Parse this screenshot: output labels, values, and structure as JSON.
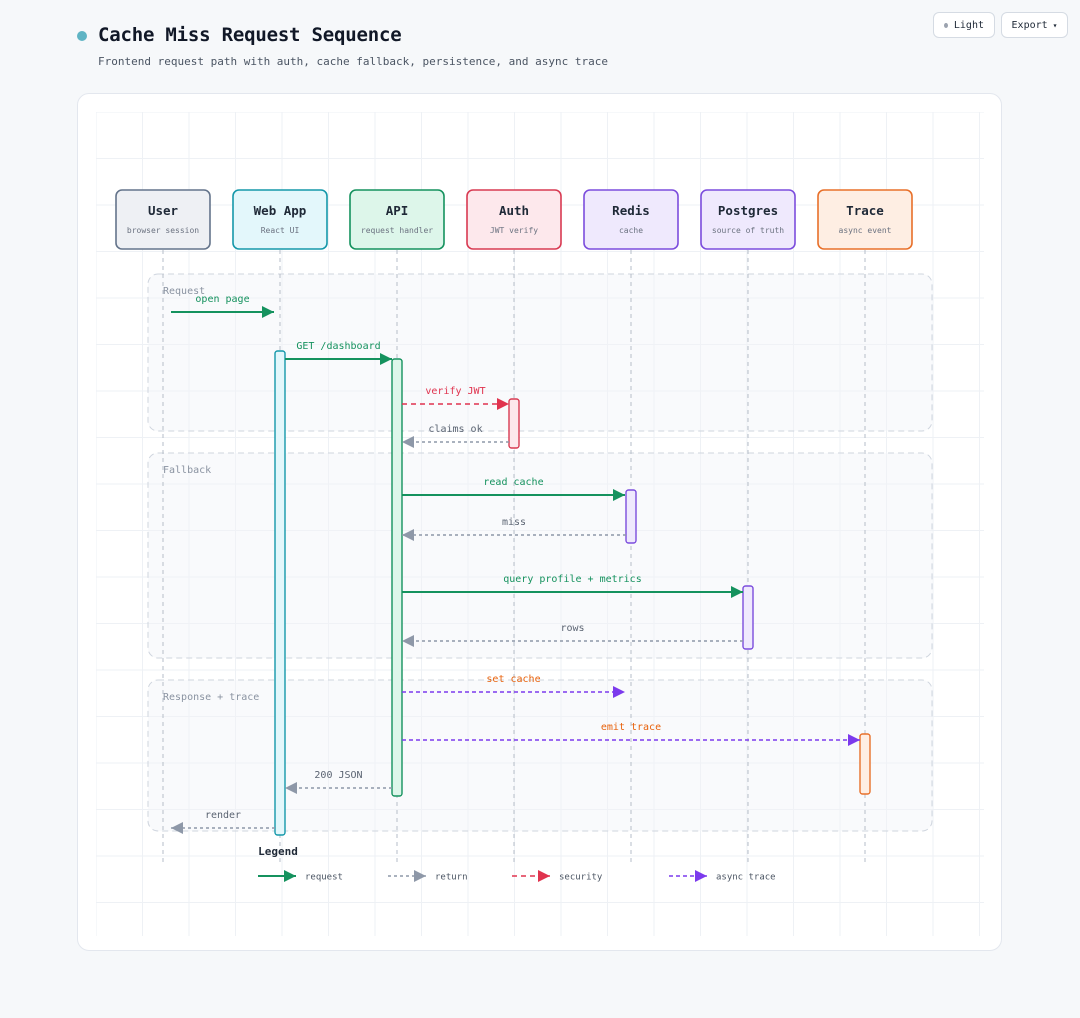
{
  "header": {
    "title": "Cache Miss Request Sequence",
    "subtitle": "Frontend request path with auth, cache fallback, persistence, and async trace"
  },
  "toolbar": {
    "theme_label": "Light",
    "export_label": "Export"
  },
  "colors": {
    "request": "#15925e",
    "return": "#8e98a8",
    "security": "#e0334e",
    "async": "#7c3aed",
    "async_label": "#e8620c"
  },
  "participants": [
    {
      "id": "user",
      "name": "User",
      "desc": "browser session",
      "border": "#64748b",
      "fill": "#eef0f4"
    },
    {
      "id": "webapp",
      "name": "Web App",
      "desc": "React UI",
      "border": "#1598aa",
      "fill": "#e3f7fb"
    },
    {
      "id": "api",
      "name": "API",
      "desc": "request handler",
      "border": "#15925e",
      "fill": "#ddf6ea"
    },
    {
      "id": "auth",
      "name": "Auth",
      "desc": "JWT verify",
      "border": "#d83a52",
      "fill": "#fde8ec"
    },
    {
      "id": "redis",
      "name": "Redis",
      "desc": "cache",
      "border": "#7c4ddd",
      "fill": "#efe9fd"
    },
    {
      "id": "postgres",
      "name": "Postgres",
      "desc": "source of truth",
      "border": "#7c4ddd",
      "fill": "#efe9fd"
    },
    {
      "id": "trace",
      "name": "Trace",
      "desc": "async event",
      "border": "#e8702a",
      "fill": "#feeee3"
    }
  ],
  "groups": [
    {
      "label": "Request"
    },
    {
      "label": "Fallback"
    },
    {
      "label": "Response + trace"
    }
  ],
  "messages": [
    {
      "from": "user",
      "to": "webapp",
      "label": "open page",
      "kind": "request"
    },
    {
      "from": "webapp",
      "to": "api",
      "label": "GET /dashboard",
      "kind": "request"
    },
    {
      "from": "api",
      "to": "auth",
      "label": "verify JWT",
      "kind": "security"
    },
    {
      "from": "auth",
      "to": "api",
      "label": "claims ok",
      "kind": "return"
    },
    {
      "from": "api",
      "to": "redis",
      "label": "read cache",
      "kind": "request"
    },
    {
      "from": "redis",
      "to": "api",
      "label": "miss",
      "kind": "return"
    },
    {
      "from": "api",
      "to": "postgres",
      "label": "query profile + metrics",
      "kind": "request"
    },
    {
      "from": "postgres",
      "to": "api",
      "label": "rows",
      "kind": "return"
    },
    {
      "from": "api",
      "to": "redis",
      "label": "set cache",
      "kind": "async"
    },
    {
      "from": "api",
      "to": "trace",
      "label": "emit trace",
      "kind": "async"
    },
    {
      "from": "api",
      "to": "webapp",
      "label": "200 JSON",
      "kind": "return"
    },
    {
      "from": "webapp",
      "to": "user",
      "label": "render",
      "kind": "return"
    }
  ],
  "activations": [
    {
      "participant": "webapp",
      "kind": "request"
    },
    {
      "participant": "api",
      "kind": "request"
    },
    {
      "participant": "auth",
      "kind": "security"
    },
    {
      "participant": "redis",
      "kind": "async"
    },
    {
      "participant": "postgres",
      "kind": "async"
    },
    {
      "participant": "trace",
      "kind": "async_label"
    }
  ],
  "legend": {
    "title": "Legend",
    "items": [
      {
        "label": "request",
        "kind": "request"
      },
      {
        "label": "return",
        "kind": "return"
      },
      {
        "label": "security",
        "kind": "security"
      },
      {
        "label": "async trace",
        "kind": "async"
      }
    ]
  }
}
